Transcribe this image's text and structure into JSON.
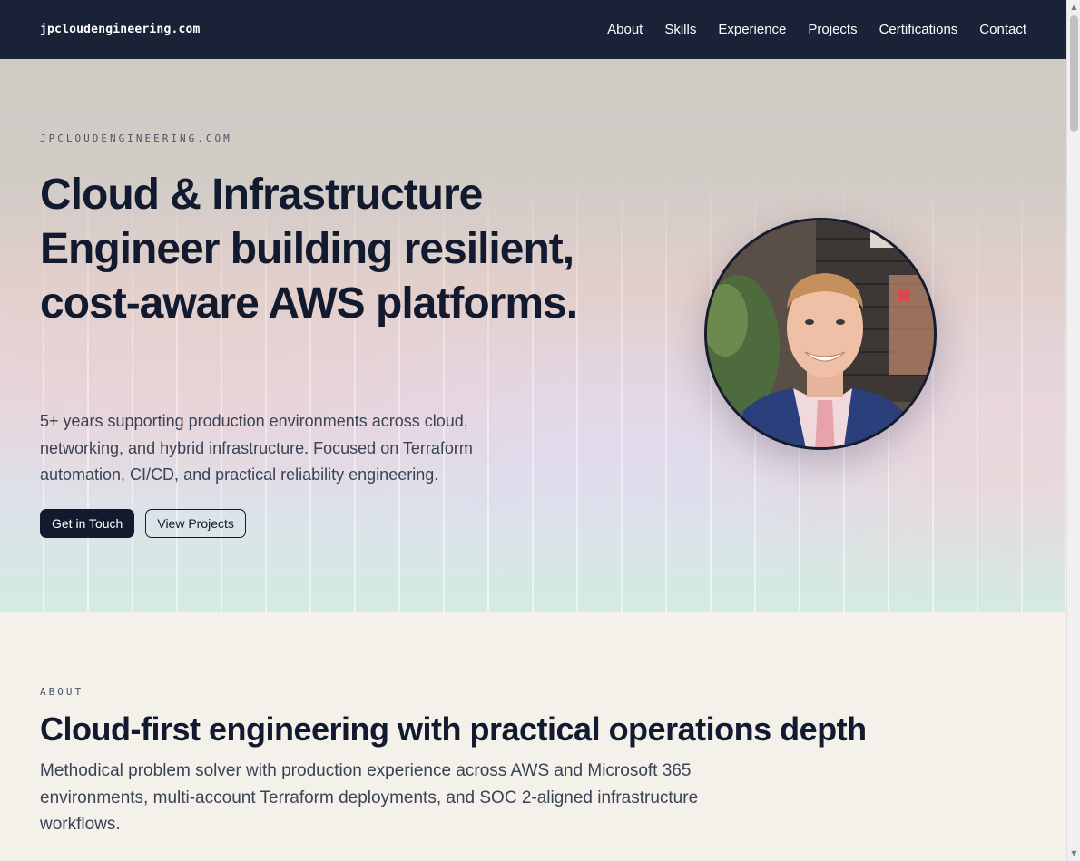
{
  "nav": {
    "brand": "jpcloudengineering.com",
    "links": [
      "About",
      "Skills",
      "Experience",
      "Projects",
      "Certifications",
      "Contact"
    ]
  },
  "hero": {
    "eyebrow": "JPCLOUDENGINEERING.COM",
    "title": "Cloud & Infrastructure Engineer building resilient, cost-aware AWS platforms.",
    "description": "5+ years supporting production environments across cloud, networking, and hybrid infrastructure. Focused on Terraform automation, CI/CD, and practical reliability engineering.",
    "primary_button": "Get in Touch",
    "secondary_button": "View Projects"
  },
  "about": {
    "eyebrow": "ABOUT",
    "title": "Cloud-first engineering with practical operations depth",
    "description": "Methodical problem solver with production experience across AWS and Microsoft 365 environments, multi-account Terraform deployments, and SOC 2-aligned infrastructure workflows."
  },
  "colors": {
    "nav_bg": "#1a2238",
    "text_dark": "#111a2e",
    "page_bg": "#f4f0ea"
  }
}
